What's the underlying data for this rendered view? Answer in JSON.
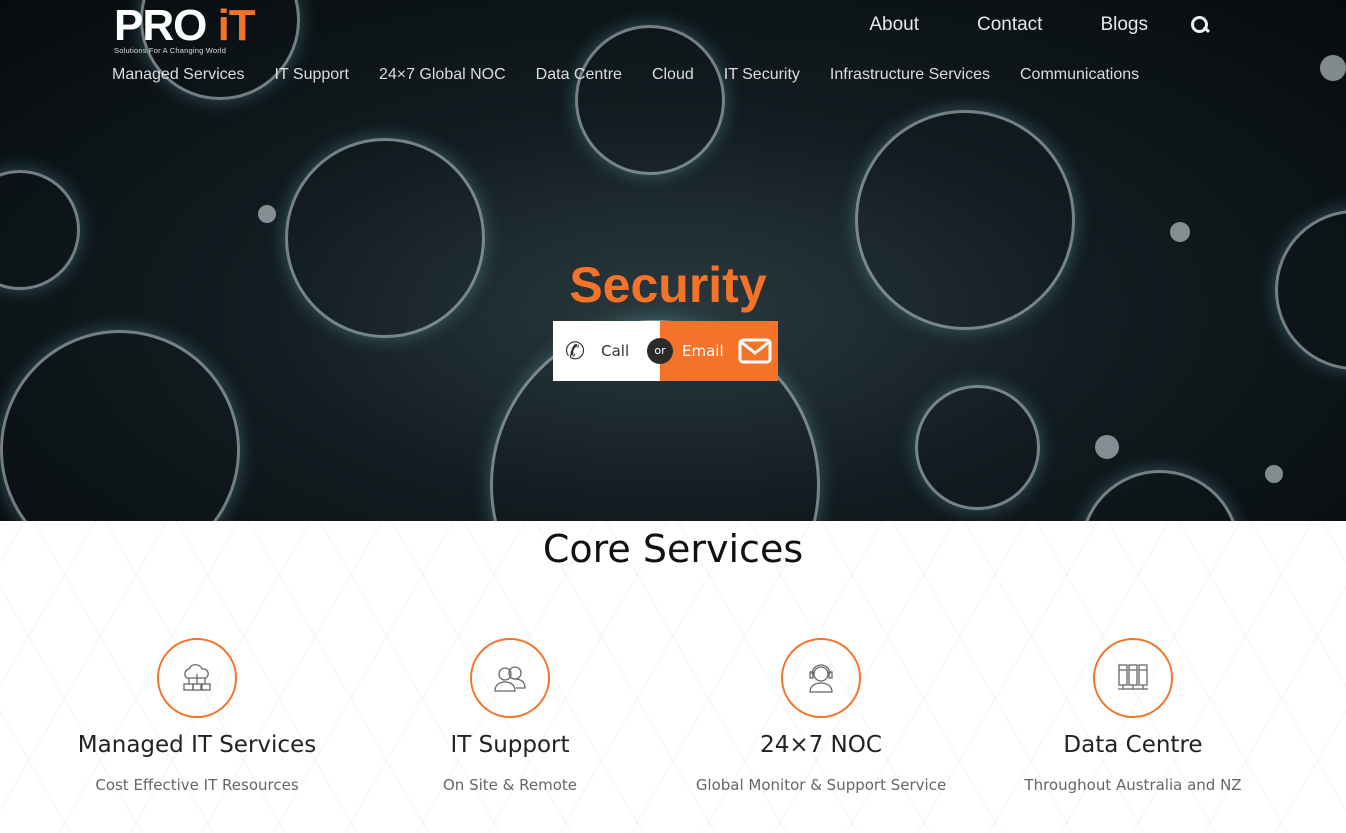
{
  "brand": {
    "name": "PRO iT",
    "tagline": "Solutions For A Changing World",
    "accent": "#f47328"
  },
  "topnav": [
    {
      "label": "About"
    },
    {
      "label": "Contact"
    },
    {
      "label": "Blogs"
    }
  ],
  "mainnav": [
    {
      "label": "Managed Services"
    },
    {
      "label": "IT Support"
    },
    {
      "label": "24×7 Global NOC"
    },
    {
      "label": "Data Centre"
    },
    {
      "label": "Cloud"
    },
    {
      "label": "IT Security"
    },
    {
      "label": "Infrastructure Services"
    },
    {
      "label": "Communications"
    }
  ],
  "hero": {
    "title": "Security",
    "call": "Call",
    "or": "or",
    "email": "Email"
  },
  "core": {
    "heading": "Core Services",
    "items": [
      {
        "title": "Managed IT Services",
        "subtitle": "Cost Effective IT Resources",
        "icon": "cloud-network-icon"
      },
      {
        "title": "IT Support",
        "subtitle": "On Site & Remote",
        "icon": "users-icon"
      },
      {
        "title": "24×7 NOC",
        "subtitle": "Global Monitor & Support Service",
        "icon": "headset-operator-icon"
      },
      {
        "title": "Data Centre",
        "subtitle": "Throughout Australia and NZ",
        "icon": "server-rack-icon"
      }
    ]
  }
}
